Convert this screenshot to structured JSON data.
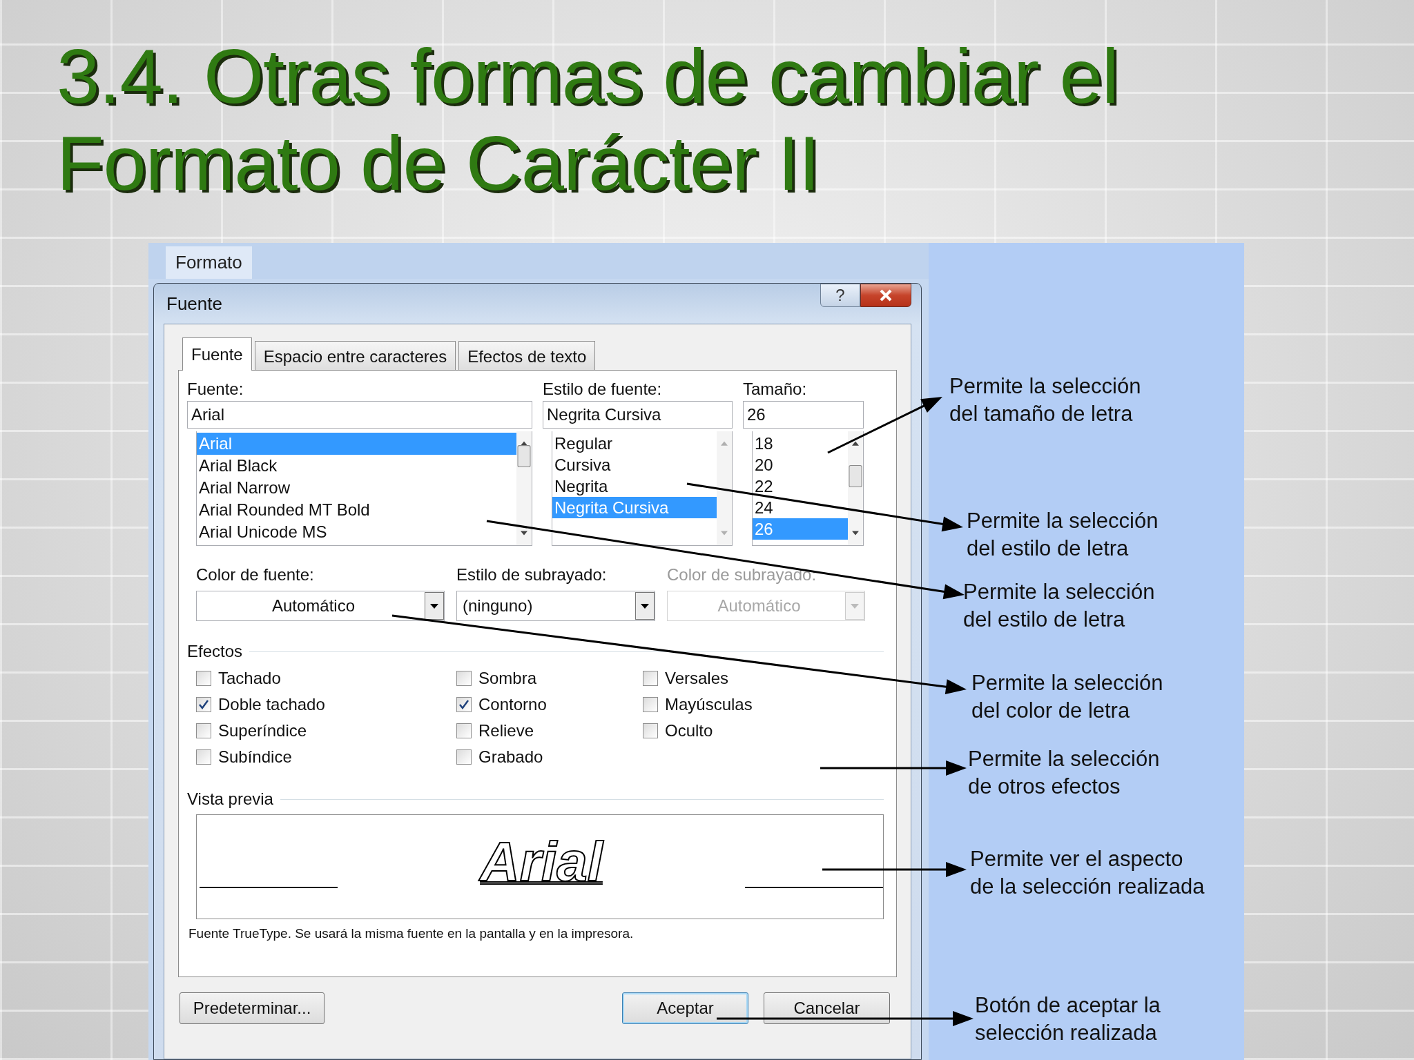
{
  "title": "3.4. Otras formas de cambiar el\nFormato de Carácter II",
  "menu": {
    "label": "Formato"
  },
  "dialog": {
    "title": "Fuente",
    "help": "?"
  },
  "tabs": [
    {
      "label": "Fuente",
      "selected": true
    },
    {
      "label": "Espacio entre caracteres",
      "selected": false
    },
    {
      "label": "Efectos de texto",
      "selected": false
    }
  ],
  "pickers": [
    {
      "label": "Fuente:",
      "value": "Arial",
      "items": [
        {
          "label": "Arial",
          "selected": true
        },
        {
          "label": "Arial Black",
          "selected": false
        },
        {
          "label": "Arial Narrow",
          "selected": false
        },
        {
          "label": "Arial Rounded MT Bold",
          "selected": false
        },
        {
          "label": "Arial Unicode MS",
          "selected": false
        }
      ]
    },
    {
      "label": "Estilo de fuente:",
      "value": "Negrita Cursiva",
      "items": [
        {
          "label": "Regular",
          "selected": false
        },
        {
          "label": "Cursiva",
          "selected": false
        },
        {
          "label": "Negrita",
          "selected": false
        },
        {
          "label": "Negrita Cursiva",
          "selected": true
        }
      ]
    },
    {
      "label": "Tamaño:",
      "value": "26",
      "items": [
        {
          "label": "18",
          "selected": false
        },
        {
          "label": "20",
          "selected": false
        },
        {
          "label": "22",
          "selected": false
        },
        {
          "label": "24",
          "selected": false
        },
        {
          "label": "26",
          "selected": true
        }
      ]
    }
  ],
  "dropdowns": [
    {
      "label": "Color de fuente:",
      "value": "Automático",
      "disabled": false
    },
    {
      "label": "Estilo de subrayado:",
      "value": "(ninguno)",
      "disabled": false
    },
    {
      "label": "Color de subrayado:",
      "value": "Automático",
      "disabled": true
    }
  ],
  "effects": {
    "label": "Efectos",
    "columns": [
      [
        {
          "label": "Tachado",
          "checked": false
        },
        {
          "label": "Doble tachado",
          "checked": true
        },
        {
          "label": "Superíndice",
          "checked": false
        },
        {
          "label": "Subíndice",
          "checked": false
        }
      ],
      [
        {
          "label": "Sombra",
          "checked": false
        },
        {
          "label": "Contorno",
          "checked": true
        },
        {
          "label": "Relieve",
          "checked": false
        },
        {
          "label": "Grabado",
          "checked": false
        }
      ],
      [
        {
          "label": "Versales",
          "checked": false
        },
        {
          "label": "Mayúsculas",
          "checked": false
        },
        {
          "label": "Oculto",
          "checked": false
        }
      ]
    ]
  },
  "preview": {
    "label": "Vista previa",
    "sample": "Arial"
  },
  "note": "Fuente TrueType. Se usará la misma fuente en la pantalla y en la impresora.",
  "buttons": [
    {
      "label": "Predeterminar...",
      "default": false
    },
    {
      "label": "Aceptar",
      "default": true
    },
    {
      "label": "Cancelar",
      "default": false
    }
  ],
  "annotations": [
    {
      "text": "Permite la selección\ndel tamaño de letra"
    },
    {
      "text": "Permite la selección\ndel estilo de letra"
    },
    {
      "text": "Permite la selección\ndel estilo de letra"
    },
    {
      "text": "Permite la selección\ndel color de letra"
    },
    {
      "text": "Permite la selección\nde otros efectos"
    },
    {
      "text": "Permite ver el aspecto\nde la selección realizada"
    },
    {
      "text": "Botón de aceptar la\nselección realizada"
    }
  ]
}
